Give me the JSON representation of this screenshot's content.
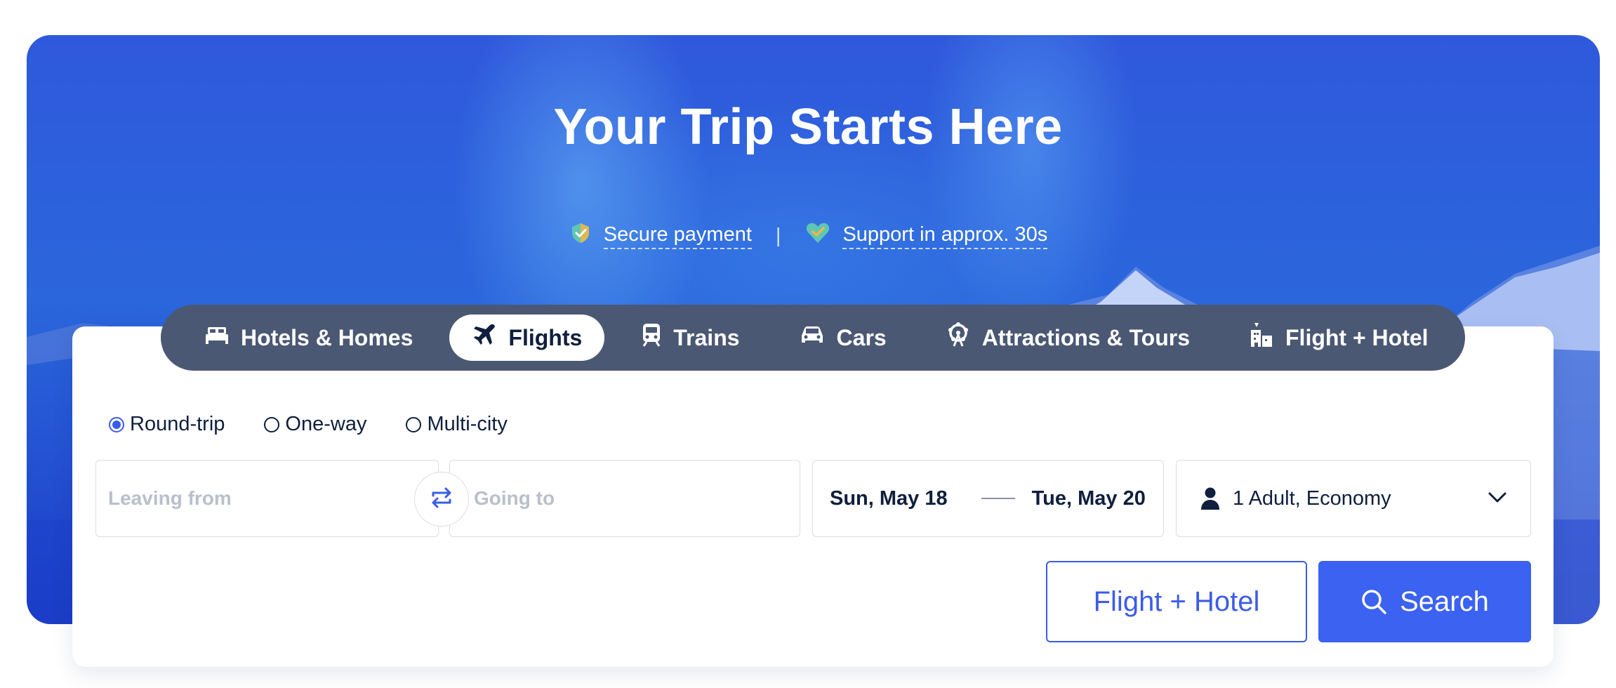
{
  "hero": {
    "title": "Your Trip Starts Here",
    "badges": [
      {
        "icon": "shield-check-icon",
        "label": "Secure payment"
      },
      {
        "icon": "heart-check-icon",
        "label": "Support in approx. 30s"
      }
    ],
    "separator": "|"
  },
  "tabs": [
    {
      "icon": "bed-icon",
      "label": "Hotels & Homes",
      "active": false
    },
    {
      "icon": "plane-icon",
      "label": "Flights",
      "active": true
    },
    {
      "icon": "train-icon",
      "label": "Trains",
      "active": false
    },
    {
      "icon": "car-icon",
      "label": "Cars",
      "active": false
    },
    {
      "icon": "ferris-wheel-icon",
      "label": "Attractions & Tours",
      "active": false
    },
    {
      "icon": "building-plane-icon",
      "label": "Flight + Hotel",
      "active": false
    }
  ],
  "trip_types": [
    {
      "label": "Round-trip",
      "checked": true
    },
    {
      "label": "One-way",
      "checked": false
    },
    {
      "label": "Multi-city",
      "checked": false
    }
  ],
  "search": {
    "from_placeholder": "Leaving from",
    "to_placeholder": "Going to",
    "depart_date": "Sun, May 18",
    "return_date": "Tue, May 20",
    "passengers": "1 Adult, Economy"
  },
  "buttons": {
    "flight_hotel": "Flight + Hotel",
    "search": "Search"
  },
  "colors": {
    "accent": "#3b62f0",
    "tabbar": "#4a5873",
    "text_dark": "#0f1f3d"
  }
}
